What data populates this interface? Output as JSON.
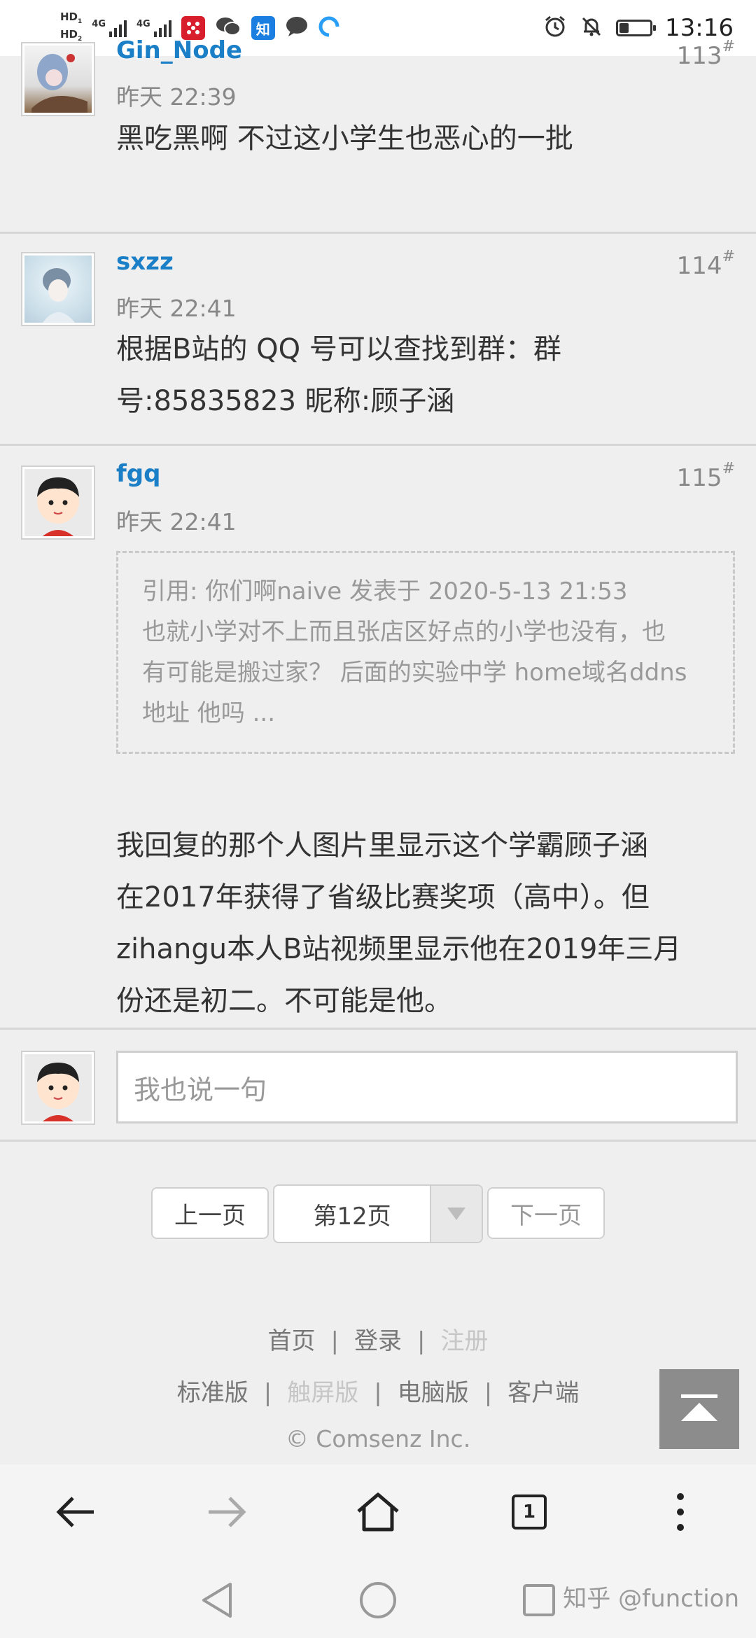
{
  "status_bar": {
    "hd1": "HD",
    "hd1_sub": "1",
    "hd2": "HD",
    "hd2_sub": "2",
    "net1": "4G",
    "net2": "4G",
    "zhihu_icon_text": "知",
    "time": "13:16",
    "battery_level": 0.28
  },
  "posts": [
    {
      "username": "Gin_Node",
      "time": "昨天 22:39",
      "floor": "113",
      "floor_mark": "#",
      "text": "黑吃黑啊  不过这小学生也恶心的一批"
    },
    {
      "username": "sxzz",
      "time": "昨天 22:41",
      "floor": "114",
      "floor_mark": "#",
      "text_lines": [
        "根据B站的 QQ 号可以查找到群：群",
        "号:85835823 昵称:顾子涵"
      ]
    },
    {
      "username": "fgq",
      "time": "昨天 22:41",
      "floor": "115",
      "floor_mark": "#",
      "quote_lines": [
        "引用: 你们啊naive 发表于 2020-5-13 21:53",
        "也就小学对不上而且张店区好点的小学也没有，也",
        "有可能是搬过家？ 后面的实验中学 home域名ddns",
        "地址 他吗 ..."
      ],
      "text_lines": [
        "我回复的那个人图片里显示这个学霸顾子涵",
        "在2017年获得了省级比赛奖项（高中）。但",
        "zihangu本人B站视频里显示他在2019年三月",
        "份还是初二。不可能是他。"
      ]
    }
  ],
  "reply": {
    "placeholder": "我也说一句"
  },
  "pager": {
    "prev": "上一页",
    "current": "第12页",
    "next": "下一页"
  },
  "footer": {
    "links_row1": [
      "首页",
      "登录",
      "注册"
    ],
    "links_row2": [
      "标准版",
      "触屏版",
      "电脑版",
      "客户端"
    ],
    "separator": "|",
    "copyright": "© Comsenz Inc."
  },
  "browser": {
    "tab_count": "1"
  },
  "watermark": "知乎 @function"
}
